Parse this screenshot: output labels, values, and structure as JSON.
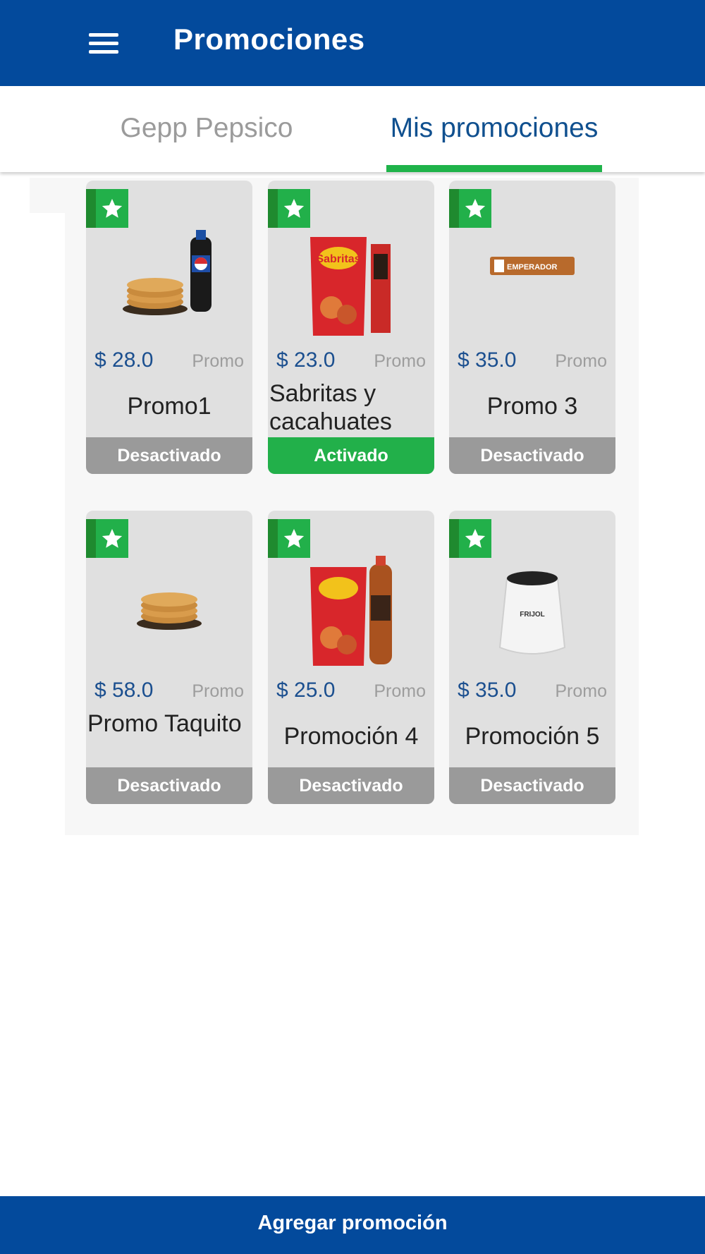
{
  "appbar": {
    "title": "Promociones",
    "accent_color": "#034a9c"
  },
  "tabs": [
    {
      "label": "Gepp Pepsico",
      "active": false
    },
    {
      "label": "Mis promociones",
      "active": true
    }
  ],
  "promotions": [
    {
      "price": "$ 28.0",
      "tag": "Promo",
      "name": "Promo1",
      "status": "Desactivado",
      "image": "tortillas-and-pepsi-bottle"
    },
    {
      "price": "$ 23.0",
      "tag": "Promo",
      "name": "Sabritas y cacahuates",
      "status": "Activado",
      "image": "sabritas-bag-and-snack"
    },
    {
      "price": "$ 35.0",
      "tag": "Promo",
      "name": "Promo 3",
      "status": "Desactivado",
      "image": "emperador-cookie-pack"
    },
    {
      "price": "$ 58.0",
      "tag": "Promo",
      "name": "Promo Taquito",
      "status": "Desactivado",
      "image": "tortillas"
    },
    {
      "price": "$ 25.0",
      "tag": "Promo",
      "name": "Promoción 4",
      "status": "Desactivado",
      "image": "sabritas-and-soda"
    },
    {
      "price": "$ 35.0",
      "tag": "Promo",
      "name": "Promoción 5",
      "status": "Desactivado",
      "image": "frijol-sack"
    }
  ],
  "labels": {
    "frijol_sack_text": "FRIJOL",
    "emperador_text": "EMPERADOR",
    "sabritas_text": "Sabritas"
  },
  "bottom_button": {
    "label": "Agregar promoción"
  },
  "colors": {
    "active_status": "#22b04a",
    "inactive_status": "#9a9a9a",
    "tab_underline": "#1fb34a"
  }
}
